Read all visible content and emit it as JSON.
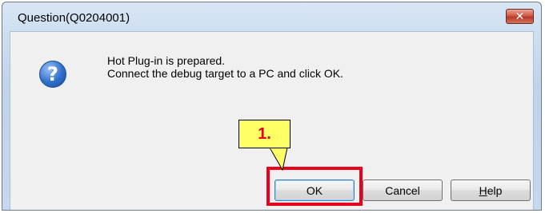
{
  "window": {
    "title": "Question(Q0204001)",
    "close_glyph": "✕"
  },
  "message": {
    "icon": "question-icon",
    "icon_glyph": "?",
    "line1": "Hot Plug-in is prepared.",
    "line2": "Connect the debug target to a PC and click OK."
  },
  "buttons": {
    "ok": "OK",
    "cancel": "Cancel",
    "help_first": "H",
    "help_rest": "elp"
  },
  "annotation": {
    "step_label": "1.",
    "highlight_color": "#e8001c",
    "callout_color": "#ffff66"
  }
}
